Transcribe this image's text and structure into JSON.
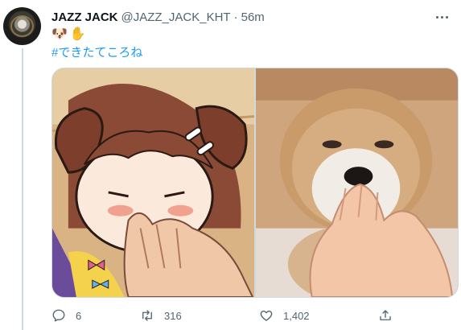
{
  "tweet": {
    "author_name": "JAZZ JACK",
    "author_handle": "@JAZZ_JACK_KHT",
    "separator": "·",
    "time": "56m",
    "emojis": [
      "🐶",
      "✋"
    ],
    "hashtag": "#できたてころね"
  },
  "media": {
    "left_photo": "anime-dog-girl-illustration",
    "right_photo": "puppy-photo"
  },
  "actions": {
    "reply_count": "6",
    "retweet_count": "316",
    "like_count": "1,402"
  },
  "colors": {
    "link": "#1d9bf0",
    "secondary_text": "#536471",
    "border": "#cfd9de"
  }
}
